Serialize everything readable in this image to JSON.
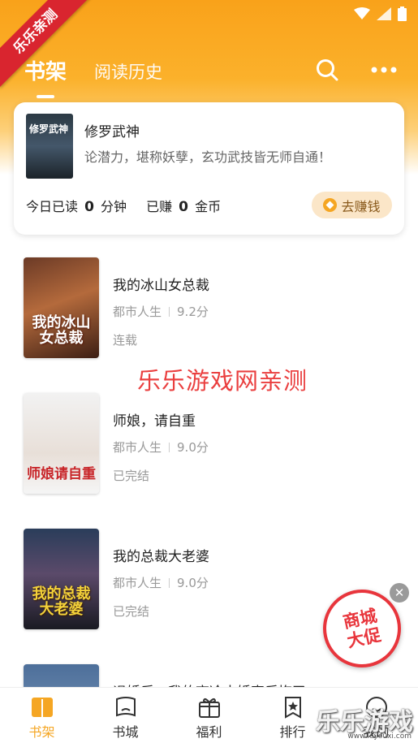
{
  "watermarks": {
    "corner": "乐乐亲测",
    "center": "乐乐游戏网亲测",
    "site": "乐乐游戏",
    "site_sub": "www.leyouxi.com"
  },
  "header": {
    "tabs": [
      {
        "label": "书架",
        "active": true
      },
      {
        "label": "阅读历史",
        "active": false
      }
    ],
    "icons": [
      "search-icon",
      "more-icon"
    ]
  },
  "recent": {
    "title": "修罗武神",
    "description": "论潜力，堪称妖孽，玄功武技皆无师自通！",
    "cover_text": "修罗武神",
    "today_read_prefix": "今日已读",
    "today_read_value": "0",
    "today_read_unit": "分钟",
    "earned_prefix": "已赚",
    "earned_value": "0",
    "earned_unit": "金币",
    "earn_button": "去赚钱"
  },
  "books": [
    {
      "title": "我的冰山女总裁",
      "category": "都市人生",
      "score": "9.2分",
      "status": "连载",
      "cover_text": "我的冰山女总裁"
    },
    {
      "title": "师娘，请自重",
      "category": "都市人生",
      "score": "9.0分",
      "status": "已完结",
      "cover_text": "师娘请自重"
    },
    {
      "title": "我的总裁大老婆",
      "category": "都市人生",
      "score": "9.0分",
      "status": "已完结",
      "cover_text": "我的总裁大老婆"
    },
    {
      "title": "退婚后，我的高冷未婚妻后悔了",
      "category": "",
      "score": "",
      "status": "",
      "cover_text": ""
    }
  ],
  "promo": {
    "line1": "商城",
    "line2": "大促"
  },
  "bottom_nav": [
    {
      "label": "书架",
      "icon": "bookshelf-icon",
      "active": true
    },
    {
      "label": "书城",
      "icon": "bookstore-icon",
      "active": false
    },
    {
      "label": "福利",
      "icon": "gift-icon",
      "active": false
    },
    {
      "label": "排行",
      "icon": "ranking-icon",
      "active": false
    },
    {
      "label": "我的",
      "icon": "profile-icon",
      "active": false
    }
  ],
  "colors": {
    "accent": "#f5a623",
    "header": "#f9a21a",
    "promo": "#e8353c",
    "watermark": "#ea3f3f"
  }
}
